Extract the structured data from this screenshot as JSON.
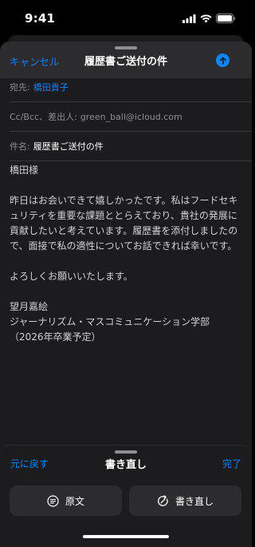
{
  "status": {
    "time": "9:41"
  },
  "nav": {
    "cancel_label": "キャンセル",
    "title": "履歴書ご送付の件"
  },
  "fields": {
    "to_label": "宛先:",
    "to_value": "橋田貴子",
    "cc_label": "Cc/Bcc、差出人:",
    "cc_value": "green_ball@icloud.com",
    "subject_label": "件名:",
    "subject_value": "履歴書ご送付の件"
  },
  "body": {
    "greeting": "橋田様",
    "paragraph1": "昨日はお会いできて嬉しかったです。私はフードセキュリティを重要な課題ととらえており、貴社の発展に貢献したいと考えています。履歴書を添付しましたので、面接で私の適性についてお話できれば幸いです。",
    "closing": "よろしくお願いいたします。",
    "signature_name": "望月嘉絵",
    "signature_dept": "ジャーナリズム・マスコミュニケーション学部",
    "signature_note": "（2026年卒業予定）"
  },
  "bottom_panel": {
    "undo_label": "元に戻す",
    "title": "書き直し",
    "done_label": "完了",
    "original_label": "原文",
    "rewrite_label": "書き直し"
  },
  "colors": {
    "accent": "#0a84ff",
    "background": "#1c1c1e",
    "nav_background": "#2c2c2e"
  },
  "icons": {
    "send": "arrow-up-icon",
    "original": "document-lines-icon",
    "rewrite": "rewrite-cycle-icon"
  }
}
